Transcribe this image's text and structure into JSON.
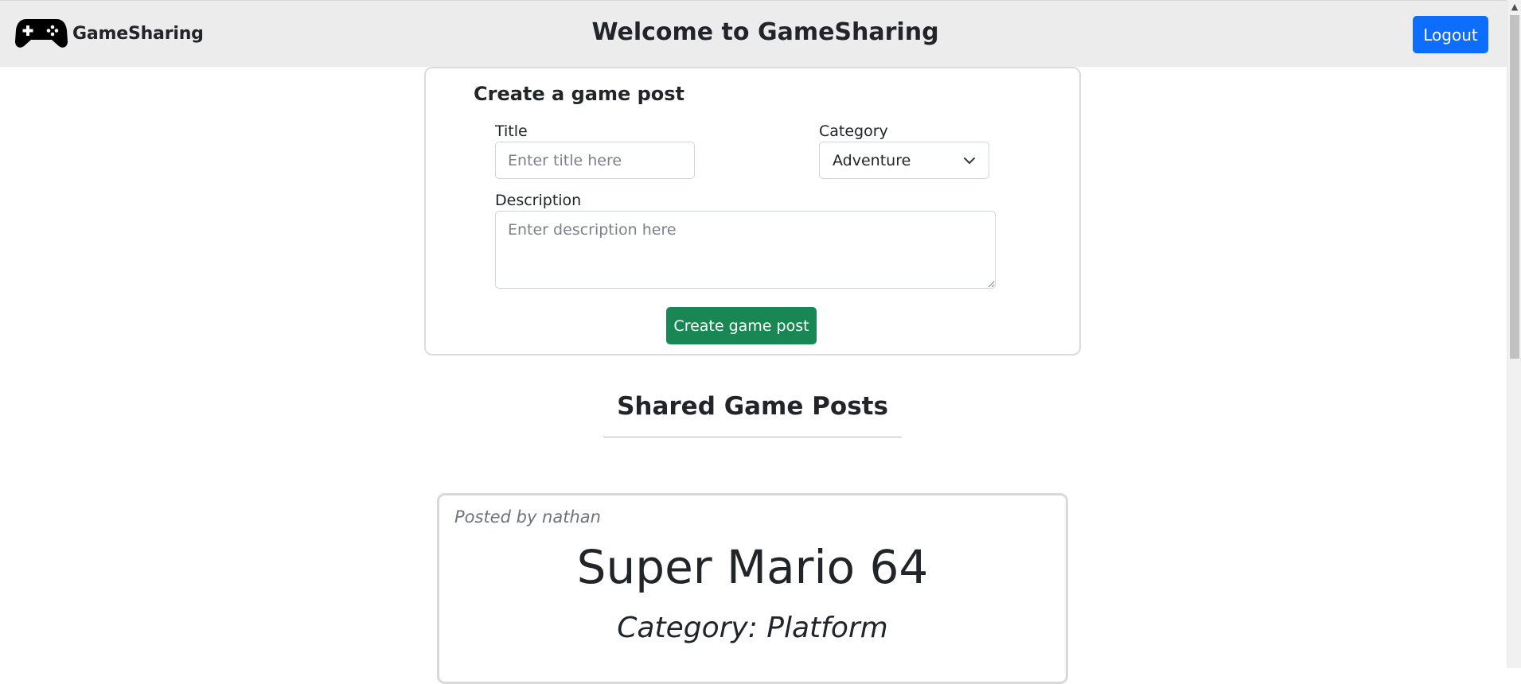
{
  "navbar": {
    "brand_name": "GameSharing",
    "brand_icon": "gamepad-icon",
    "title": "Welcome to GameSharing",
    "logout_label": "Logout"
  },
  "create_form": {
    "heading": "Create a game post",
    "title_label": "Title",
    "title_placeholder": "Enter title here",
    "title_value": "",
    "category_label": "Category",
    "category_selected": "Adventure",
    "description_label": "Description",
    "description_placeholder": "Enter description here",
    "description_value": "",
    "submit_label": "Create game post"
  },
  "posts_section": {
    "heading": "Shared Game Posts",
    "posts": [
      {
        "author_line": "Posted by nathan",
        "title": "Super Mario 64",
        "category_line": "Category: Platform"
      }
    ]
  },
  "colors": {
    "navbar_bg": "#ececec",
    "logout_button": "#0d6efd",
    "create_button": "#198754",
    "muted_text": "#6c757d"
  }
}
